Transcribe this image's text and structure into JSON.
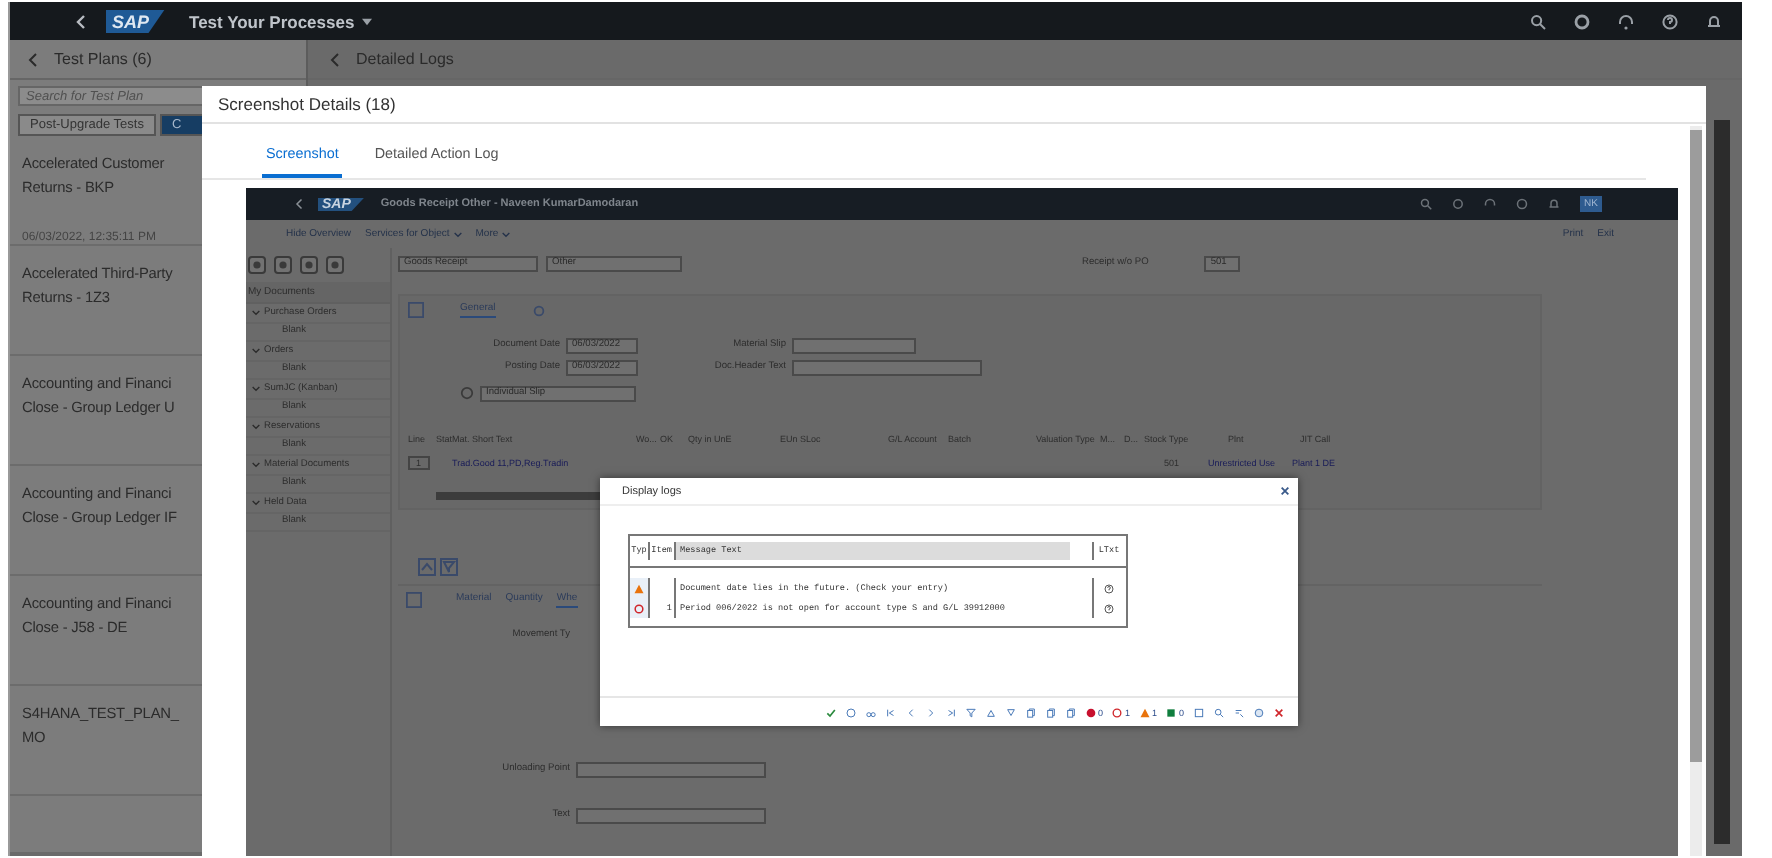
{
  "shell": {
    "logo": "SAP",
    "title": "Test Your Processes"
  },
  "left_panel": {
    "heading": "Test Plans (6)",
    "search": {
      "placeholder": "Search for Test Plan"
    },
    "tabs": [
      {
        "label": "Post-Upgrade Tests",
        "selected": false
      },
      {
        "label": "C",
        "selected": true
      }
    ],
    "items": [
      {
        "lines": [
          "Accelerated Customer",
          "Returns - BKP"
        ],
        "timestamp": "06/03/2022, 12:35:11 PM"
      },
      {
        "lines": [
          "Accelerated Third-Party",
          "Returns - 1Z3"
        ]
      },
      {
        "lines": [
          "Accounting and Financi",
          "Close - Group Ledger U"
        ]
      },
      {
        "lines": [
          "Accounting and Financi",
          "Close - Group Ledger IF"
        ]
      },
      {
        "lines": [
          "Accounting and Financi",
          "Close - J58 - DE"
        ]
      },
      {
        "lines": [
          "S4HANA_TEST_PLAN_",
          "MO"
        ]
      }
    ]
  },
  "detail_header": {
    "title": "Detailed Logs"
  },
  "dialog": {
    "title": "Screenshot Details (18)",
    "tabs": [
      {
        "label": "Screenshot",
        "selected": true
      },
      {
        "label": "Detailed Action Log",
        "selected": false
      }
    ],
    "screenshot": {
      "logo": "SAP",
      "title": "Goods Receipt Other - Naveen KumarDamodaran",
      "avatar": "NK",
      "menu": [
        {
          "label": "Hide Overview",
          "dropdown": false
        },
        {
          "label": "Services for Object",
          "dropdown": true
        },
        {
          "label": "More",
          "dropdown": true
        }
      ],
      "actions": [
        "Print",
        "Exit"
      ],
      "transaction": "Goods Receipt",
      "reference": "Other",
      "receipt_label": "Receipt w/o PO",
      "movement_code": "501",
      "tree": {
        "heading": "My Documents",
        "nodes": [
          {
            "label": "Purchase Orders",
            "expanded": true,
            "children": [
              {
                "label": "Blank"
              }
            ]
          },
          {
            "label": "Orders",
            "expanded": true,
            "children": [
              {
                "label": "Blank"
              }
            ]
          },
          {
            "label": "SumJC (Kanban)",
            "expanded": true,
            "children": [
              {
                "label": "Blank"
              }
            ]
          },
          {
            "label": "Reservations",
            "expanded": true,
            "children": [
              {
                "label": "Blank"
              }
            ]
          },
          {
            "label": "Material Documents",
            "expanded": true,
            "children": [
              {
                "label": "Blank"
              }
            ]
          },
          {
            "label": "Held Data",
            "expanded": true,
            "children": [
              {
                "label": "Blank"
              }
            ]
          }
        ]
      },
      "header_tabs": [
        {
          "label": "General",
          "selected": true
        }
      ],
      "header_fields": [
        {
          "label": "Document Date",
          "value": "06/03/2022"
        },
        {
          "label": "Posting Date",
          "value": "06/03/2022"
        }
      ],
      "side_fields": [
        {
          "label": "Material Slip"
        },
        {
          "label": "Doc.Header Text"
        }
      ],
      "slip_option": "Individual Slip",
      "items_table": {
        "columns": [
          "Line",
          "Stat",
          "Mat. Short Text",
          "Wo...",
          "OK",
          "Qty in UnE",
          "EUn",
          "SLoc",
          "G/L Account",
          "Batch",
          "Valuation Type",
          "M...",
          "D...",
          "Stock Type",
          "Plnt",
          "JIT Call"
        ],
        "row": {
          "line": "1",
          "short_text": "Trad.Good 11,PD,Reg.Tradin",
          "movement": "501",
          "stock_type": "Unrestricted Use",
          "plant": "Plant 1 DE"
        }
      },
      "detail_tabs": [
        {
          "label": "Material",
          "selected": false
        },
        {
          "label": "Quantity",
          "selected": false
        },
        {
          "label": "Whe",
          "selected": true
        }
      ],
      "detail_fields": [
        {
          "label": "Movement Ty"
        },
        {
          "label": "Unloading Point"
        },
        {
          "label": "Text"
        }
      ],
      "log_dialog": {
        "title": "Display logs",
        "columns": [
          "Typ",
          "Item",
          "Message Text",
          "LTxt"
        ],
        "rows": [
          {
            "kind": "warning",
            "item": "",
            "text": "Document date lies in the future. (Check your entry)"
          },
          {
            "kind": "error",
            "item": "1",
            "text": "Period 006/2022 is not open for account type S and G/L 39912000"
          }
        ],
        "counters": [
          {
            "kind": "stop",
            "count": "0"
          },
          {
            "kind": "error",
            "count": "1"
          },
          {
            "kind": "warning",
            "count": "1"
          },
          {
            "kind": "success",
            "count": "0"
          }
        ]
      }
    }
  }
}
